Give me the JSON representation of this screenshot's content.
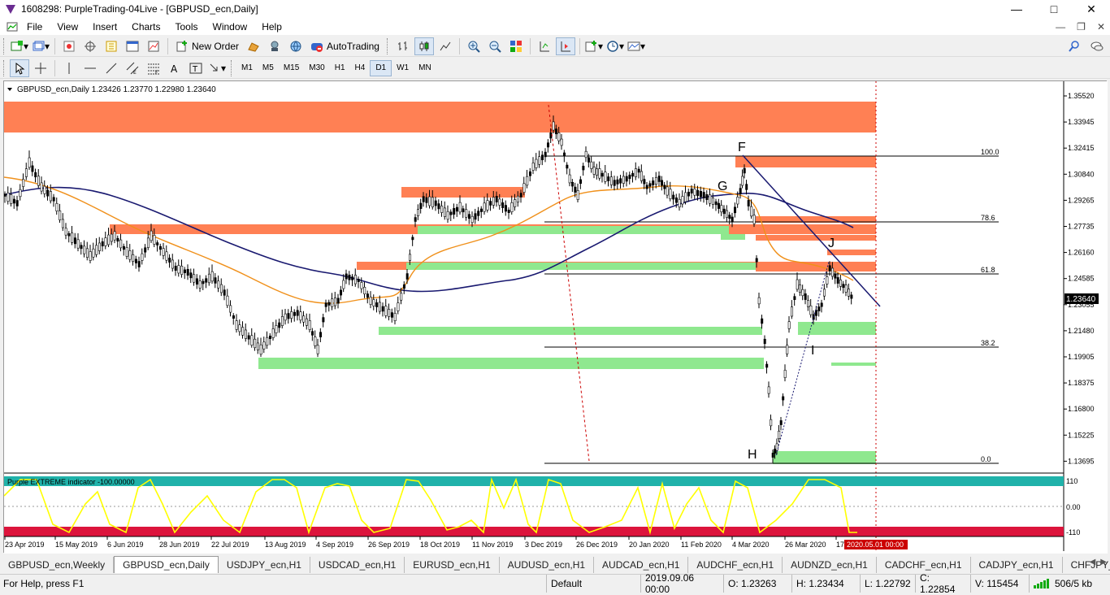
{
  "window": {
    "title": "1608298: PurpleTrading-04Live - [GBPUSD_ecn,Daily]"
  },
  "menu": [
    "File",
    "View",
    "Insert",
    "Charts",
    "Tools",
    "Window",
    "Help"
  ],
  "toolbar": {
    "new_order": "New Order",
    "auto_trading": "AutoTrading"
  },
  "timeframes": [
    "M1",
    "M5",
    "M15",
    "M30",
    "H1",
    "H4",
    "D1",
    "W1",
    "MN"
  ],
  "selected_timeframe": "D1",
  "chart": {
    "header": "GBPUSD_ecn,Daily  1.23426 1.23770 1.22980 1.23640",
    "current_price": "1.23640",
    "price_labels": [
      "1.35520",
      "1.33945",
      "1.32415",
      "1.30840",
      "1.29265",
      "1.27735",
      "1.26160",
      "1.24585",
      "1.23055",
      "1.21480",
      "1.19905",
      "1.18375",
      "1.16800",
      "1.15225",
      "1.13695"
    ],
    "date_labels": [
      "23 Apr 2019",
      "15 May 2019",
      "6 Jun 2019",
      "28 Jun 2019",
      "22 Jul 2019",
      "13 Aug 2019",
      "4 Sep 2019",
      "26 Sep 2019",
      "18 Oct 2019",
      "11 Nov 2019",
      "3 Dec 2019",
      "26 Dec 2019",
      "20 Jan 2020",
      "11 Feb 2020",
      "4 Mar 2020",
      "26 Mar 2020",
      "17"
    ],
    "cursor_date": "2020.05.01 00:00",
    "fib_labels": [
      "100.0",
      "78.6",
      "61.8",
      "38.2",
      "0.0"
    ],
    "wave_labels": [
      "F",
      "G",
      "J",
      "H",
      "I"
    ],
    "indicator": {
      "label": "Purple EXTREME indicator -100.00000",
      "levels": [
        "110",
        "0.00",
        "-110"
      ]
    },
    "colors": {
      "resistance": "#ff8054",
      "support": "#8fe88f",
      "ma_fast": "#f0901a",
      "ma_slow": "#191970",
      "indicator": "#ffff00",
      "ind_top": "#20b2aa",
      "ind_bottom": "#dc143c"
    }
  },
  "tabs": [
    "GBPUSD_ecn,Weekly",
    "GBPUSD_ecn,Daily",
    "USDJPY_ecn,H1",
    "USDCAD_ecn,H1",
    "EURUSD_ecn,H1",
    "AUDUSD_ecn,H1",
    "AUDCAD_ecn,H1",
    "AUDCHF_ecn,H1",
    "AUDNZD_ecn,H1",
    "CADCHF_ecn,H1",
    "CADJPY_ecn,H1",
    "CHFJPY_ecn,"
  ],
  "active_tab": 1,
  "status": {
    "help": "For Help, press F1",
    "profile": "Default",
    "datetime": "2019.09.06 00:00",
    "open": "O: 1.23263",
    "high": "H: 1.23434",
    "low": "L: 1.22792",
    "close": "C: 1.22854",
    "volume": "V: 115454",
    "traffic": "506/5 kb"
  }
}
